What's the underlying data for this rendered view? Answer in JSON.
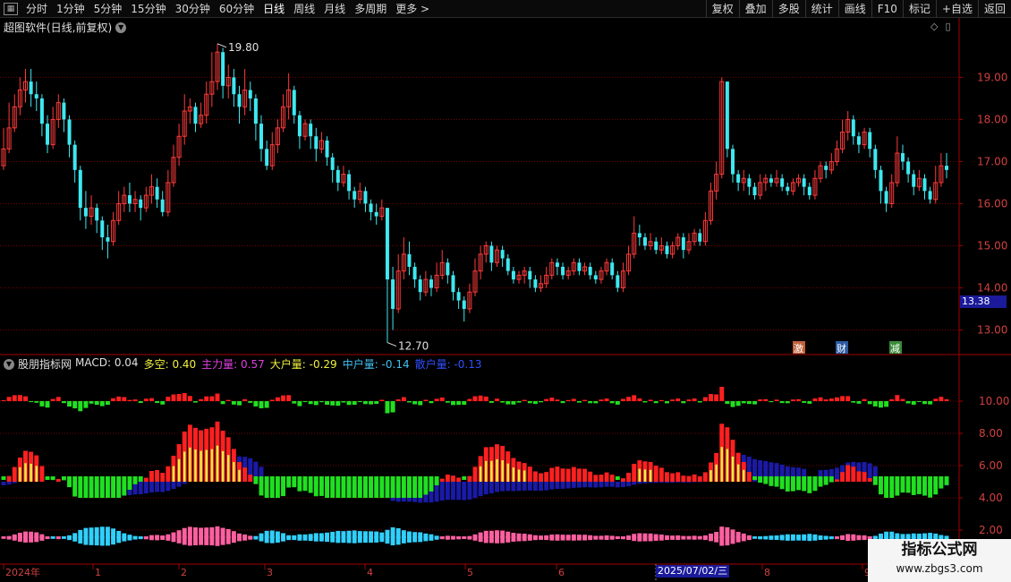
{
  "toolbar": {
    "left_items": [
      "分时",
      "1分钟",
      "5分钟",
      "15分钟",
      "30分钟",
      "60分钟",
      "日线",
      "周线",
      "月线",
      "多周期",
      "更多 >"
    ],
    "active_index": 6,
    "right_items": [
      "复权",
      "叠加",
      "多股",
      "统计",
      "画线",
      "F10",
      "标记",
      "+自选",
      "返回"
    ]
  },
  "main_chart": {
    "title": "超图软件(日线,前复权)",
    "y_ticks": [
      "19.00",
      "18.00",
      "17.00",
      "16.00",
      "15.00",
      "14.00",
      "13.00"
    ],
    "current_price": "13.38",
    "high_label": "19.80",
    "low_label": "12.70",
    "tags": [
      "激",
      "财",
      "减"
    ]
  },
  "indicator": {
    "name": "股朋指标网",
    "items": [
      {
        "label": "MACD:",
        "value": "0.04",
        "color": "#e0e0e0"
      },
      {
        "label": "多空:",
        "value": "0.40",
        "color": "#f0f040"
      },
      {
        "label": "主力量:",
        "value": "0.57",
        "color": "#e040e0"
      },
      {
        "label": "大户量:",
        "value": "-0.29",
        "color": "#f0f040"
      },
      {
        "label": "中户量:",
        "value": "-0.14",
        "color": "#40c0f0"
      },
      {
        "label": "散户量:",
        "value": "-0.13",
        "color": "#3050ff"
      }
    ],
    "y_ticks": [
      "10.00",
      "8.00",
      "6.00",
      "4.00",
      "2.00"
    ]
  },
  "xaxis": {
    "labels": [
      "2024年",
      "1",
      "2",
      "3",
      "4",
      "5",
      "6",
      "7",
      "8",
      "9"
    ],
    "cursor_date": "2025/07/02/三"
  },
  "watermark": {
    "line1": "指标公式网",
    "line2": "www.zbgs3.com"
  },
  "colors": {
    "up": "#ff3a3a",
    "down": "#3ee8f0",
    "grid": "#7a0000",
    "axis": "#a00000"
  },
  "chart_data": {
    "type": "candlestick",
    "price_range": [
      12.5,
      20.2
    ],
    "candles": [
      [
        16.9,
        17.3,
        16.8,
        17.8
      ],
      [
        17.3,
        17.8,
        17.2,
        18.4
      ],
      [
        17.8,
        18.3,
        17.7,
        18.6
      ],
      [
        18.3,
        18.7,
        18.1,
        19.0
      ],
      [
        18.7,
        18.9,
        18.4,
        19.2
      ],
      [
        18.9,
        18.6,
        18.3,
        19.2
      ],
      [
        18.6,
        18.5,
        18.2,
        18.9
      ],
      [
        18.5,
        17.9,
        17.6,
        18.6
      ],
      [
        17.9,
        17.4,
        17.2,
        18.1
      ],
      [
        17.4,
        18.0,
        17.3,
        18.3
      ],
      [
        18.0,
        18.4,
        17.8,
        18.6
      ],
      [
        18.4,
        18.0,
        17.7,
        18.5
      ],
      [
        18.0,
        17.4,
        17.1,
        18.1
      ],
      [
        17.4,
        16.8,
        16.5,
        17.5
      ],
      [
        16.8,
        15.9,
        15.6,
        16.9
      ],
      [
        15.9,
        15.7,
        15.4,
        16.3
      ],
      [
        15.7,
        15.9,
        15.5,
        16.2
      ],
      [
        15.9,
        15.6,
        15.3,
        16.0
      ],
      [
        15.6,
        15.2,
        14.9,
        15.7
      ],
      [
        15.2,
        15.1,
        14.7,
        15.5
      ],
      [
        15.1,
        15.6,
        15.0,
        15.8
      ],
      [
        15.6,
        16.0,
        15.5,
        16.3
      ],
      [
        16.0,
        16.2,
        15.8,
        16.4
      ],
      [
        16.2,
        16.0,
        15.8,
        16.5
      ],
      [
        16.0,
        16.1,
        15.8,
        16.3
      ],
      [
        16.1,
        15.9,
        15.6,
        16.2
      ],
      [
        15.9,
        16.2,
        15.8,
        16.4
      ],
      [
        16.2,
        16.4,
        16.0,
        16.7
      ],
      [
        16.4,
        16.1,
        15.9,
        16.6
      ],
      [
        16.1,
        15.8,
        15.7,
        16.3
      ],
      [
        15.8,
        16.5,
        15.7,
        16.8
      ],
      [
        16.5,
        17.1,
        16.4,
        17.4
      ],
      [
        17.1,
        17.6,
        16.9,
        17.9
      ],
      [
        17.6,
        18.2,
        17.4,
        18.6
      ],
      [
        18.2,
        18.3,
        17.9,
        18.5
      ],
      [
        18.3,
        17.9,
        17.7,
        18.4
      ],
      [
        17.9,
        18.1,
        17.8,
        18.4
      ],
      [
        18.1,
        18.6,
        17.9,
        18.9
      ],
      [
        18.6,
        18.9,
        18.3,
        19.6
      ],
      [
        18.9,
        19.6,
        18.7,
        19.8
      ],
      [
        19.6,
        18.8,
        18.5,
        19.7
      ],
      [
        18.8,
        19.0,
        18.5,
        19.3
      ],
      [
        19.0,
        18.6,
        18.3,
        19.2
      ],
      [
        18.6,
        18.3,
        17.9,
        18.8
      ],
      [
        18.3,
        18.7,
        18.1,
        19.2
      ],
      [
        18.7,
        18.5,
        18.2,
        18.9
      ],
      [
        18.5,
        17.9,
        17.5,
        18.6
      ],
      [
        17.9,
        17.3,
        17.0,
        18.1
      ],
      [
        17.3,
        16.9,
        16.8,
        17.5
      ],
      [
        16.9,
        17.4,
        16.8,
        17.7
      ],
      [
        17.4,
        17.8,
        17.2,
        18.0
      ],
      [
        17.8,
        18.3,
        17.7,
        18.6
      ],
      [
        18.3,
        18.7,
        18.0,
        19.1
      ],
      [
        18.7,
        18.1,
        17.9,
        18.8
      ],
      [
        18.1,
        17.6,
        17.3,
        18.2
      ],
      [
        17.6,
        17.9,
        17.5,
        18.0
      ],
      [
        17.9,
        17.6,
        17.3,
        18.0
      ],
      [
        17.6,
        17.3,
        17.0,
        17.8
      ],
      [
        17.3,
        17.5,
        17.2,
        17.7
      ],
      [
        17.5,
        17.1,
        16.9,
        17.6
      ],
      [
        17.1,
        16.8,
        16.5,
        17.2
      ],
      [
        16.8,
        16.5,
        16.3,
        16.9
      ],
      [
        16.5,
        16.7,
        16.4,
        16.9
      ],
      [
        16.7,
        16.3,
        16.1,
        16.8
      ],
      [
        16.3,
        16.1,
        15.9,
        16.4
      ],
      [
        16.1,
        16.3,
        16.0,
        16.5
      ],
      [
        16.3,
        16.0,
        15.8,
        16.4
      ],
      [
        16.0,
        15.8,
        15.6,
        16.1
      ],
      [
        15.8,
        15.7,
        15.5,
        16.0
      ],
      [
        15.7,
        15.9,
        15.6,
        16.1
      ],
      [
        15.9,
        14.2,
        12.7,
        15.0
      ],
      [
        14.2,
        13.5,
        13.0,
        14.5
      ],
      [
        13.5,
        14.4,
        13.4,
        14.8
      ],
      [
        14.4,
        14.8,
        14.2,
        15.2
      ],
      [
        14.8,
        14.5,
        14.3,
        15.1
      ],
      [
        14.5,
        14.2,
        14.0,
        14.6
      ],
      [
        14.2,
        13.9,
        13.7,
        14.3
      ],
      [
        13.9,
        14.2,
        13.8,
        14.4
      ],
      [
        14.2,
        14.0,
        13.8,
        14.3
      ],
      [
        14.0,
        14.3,
        13.9,
        14.6
      ],
      [
        14.3,
        14.6,
        14.2,
        14.9
      ],
      [
        14.6,
        14.3,
        14.1,
        14.7
      ],
      [
        14.3,
        13.9,
        13.7,
        14.4
      ],
      [
        13.9,
        13.7,
        13.5,
        14.0
      ],
      [
        13.7,
        13.5,
        13.2,
        13.8
      ],
      [
        13.5,
        13.9,
        13.4,
        14.1
      ],
      [
        13.9,
        14.4,
        13.8,
        14.7
      ],
      [
        14.4,
        14.8,
        14.2,
        15.0
      ],
      [
        14.8,
        15.0,
        14.6,
        15.1
      ],
      [
        15.0,
        14.6,
        14.4,
        15.1
      ],
      [
        14.6,
        14.9,
        14.5,
        15.0
      ],
      [
        14.9,
        14.7,
        14.5,
        15.0
      ],
      [
        14.7,
        14.4,
        14.3,
        14.8
      ],
      [
        14.4,
        14.2,
        14.1,
        14.5
      ],
      [
        14.2,
        14.3,
        14.1,
        14.4
      ],
      [
        14.3,
        14.4,
        14.1,
        14.5
      ],
      [
        14.4,
        14.2,
        14.0,
        14.5
      ],
      [
        14.2,
        14.0,
        13.9,
        14.3
      ],
      [
        14.0,
        14.1,
        13.9,
        14.3
      ],
      [
        14.1,
        14.3,
        14.0,
        14.5
      ],
      [
        14.3,
        14.6,
        14.2,
        14.7
      ],
      [
        14.6,
        14.5,
        14.3,
        14.7
      ],
      [
        14.5,
        14.3,
        14.2,
        14.6
      ],
      [
        14.3,
        14.4,
        14.2,
        14.5
      ],
      [
        14.4,
        14.6,
        14.3,
        14.7
      ],
      [
        14.6,
        14.4,
        14.3,
        14.7
      ],
      [
        14.4,
        14.5,
        14.3,
        14.6
      ],
      [
        14.5,
        14.3,
        14.2,
        14.6
      ],
      [
        14.3,
        14.2,
        14.1,
        14.4
      ],
      [
        14.2,
        14.4,
        14.1,
        14.5
      ],
      [
        14.4,
        14.6,
        14.3,
        14.7
      ],
      [
        14.6,
        14.3,
        14.2,
        14.7
      ],
      [
        14.3,
        14.0,
        13.9,
        14.4
      ],
      [
        14.0,
        14.4,
        13.9,
        14.6
      ],
      [
        14.4,
        14.8,
        14.3,
        15.0
      ],
      [
        14.8,
        15.3,
        14.7,
        15.7
      ],
      [
        15.3,
        15.2,
        15.0,
        15.5
      ],
      [
        15.2,
        15.0,
        14.9,
        15.3
      ],
      [
        15.0,
        15.1,
        14.9,
        15.3
      ],
      [
        15.1,
        14.9,
        14.8,
        15.2
      ],
      [
        14.9,
        15.0,
        14.8,
        15.2
      ],
      [
        15.0,
        14.8,
        14.7,
        15.1
      ],
      [
        14.8,
        15.0,
        14.7,
        15.1
      ],
      [
        15.0,
        15.2,
        14.9,
        15.3
      ],
      [
        15.2,
        14.9,
        14.7,
        15.3
      ],
      [
        14.9,
        15.1,
        14.8,
        15.3
      ],
      [
        15.1,
        15.3,
        15.0,
        15.4
      ],
      [
        15.3,
        15.1,
        15.0,
        15.4
      ],
      [
        15.1,
        15.6,
        15.0,
        15.8
      ],
      [
        15.6,
        16.3,
        15.5,
        16.5
      ],
      [
        16.3,
        16.7,
        16.1,
        17.0
      ],
      [
        16.7,
        18.9,
        16.6,
        19.0
      ],
      [
        18.9,
        17.3,
        17.1,
        18.9
      ],
      [
        17.3,
        16.7,
        16.5,
        17.4
      ],
      [
        16.7,
        16.5,
        16.3,
        16.8
      ],
      [
        16.5,
        16.6,
        16.3,
        16.8
      ],
      [
        16.6,
        16.4,
        16.2,
        16.7
      ],
      [
        16.4,
        16.2,
        16.1,
        16.5
      ],
      [
        16.2,
        16.5,
        16.1,
        16.7
      ],
      [
        16.5,
        16.6,
        16.3,
        16.7
      ],
      [
        16.6,
        16.5,
        16.4,
        16.7
      ],
      [
        16.5,
        16.6,
        16.4,
        16.8
      ],
      [
        16.6,
        16.4,
        16.3,
        16.7
      ],
      [
        16.4,
        16.3,
        16.2,
        16.5
      ],
      [
        16.3,
        16.5,
        16.2,
        16.6
      ],
      [
        16.5,
        16.6,
        16.4,
        16.7
      ],
      [
        16.6,
        16.4,
        16.2,
        16.7
      ],
      [
        16.4,
        16.2,
        16.1,
        16.5
      ],
      [
        16.2,
        16.6,
        16.1,
        16.8
      ],
      [
        16.6,
        16.9,
        16.5,
        17.0
      ],
      [
        16.9,
        16.8,
        16.6,
        17.0
      ],
      [
        16.8,
        17.0,
        16.7,
        17.2
      ],
      [
        17.0,
        17.3,
        16.9,
        17.5
      ],
      [
        17.3,
        17.7,
        17.2,
        18.0
      ],
      [
        17.7,
        18.0,
        17.5,
        18.2
      ],
      [
        18.0,
        17.6,
        17.4,
        18.1
      ],
      [
        17.6,
        17.4,
        17.2,
        17.7
      ],
      [
        17.4,
        17.7,
        17.3,
        17.8
      ],
      [
        17.7,
        17.3,
        17.1,
        17.8
      ],
      [
        17.3,
        16.8,
        16.6,
        17.4
      ],
      [
        16.8,
        16.3,
        16.0,
        16.9
      ],
      [
        16.3,
        16.0,
        15.8,
        16.4
      ],
      [
        16.0,
        16.5,
        15.9,
        16.7
      ],
      [
        16.5,
        17.2,
        16.4,
        17.6
      ],
      [
        17.2,
        17.0,
        16.8,
        17.4
      ],
      [
        17.0,
        16.7,
        16.5,
        17.1
      ],
      [
        16.7,
        16.4,
        16.2,
        16.8
      ],
      [
        16.4,
        16.6,
        16.3,
        16.8
      ],
      [
        16.6,
        16.3,
        16.1,
        16.7
      ],
      [
        16.3,
        16.1,
        16.0,
        16.4
      ],
      [
        16.1,
        16.5,
        16.0,
        16.9
      ],
      [
        16.5,
        16.9,
        16.4,
        17.2
      ],
      [
        16.9,
        16.8,
        16.6,
        17.2
      ]
    ],
    "indicator_series": {
      "name": "MACD",
      "axis_range": [
        0,
        12
      ]
    }
  }
}
